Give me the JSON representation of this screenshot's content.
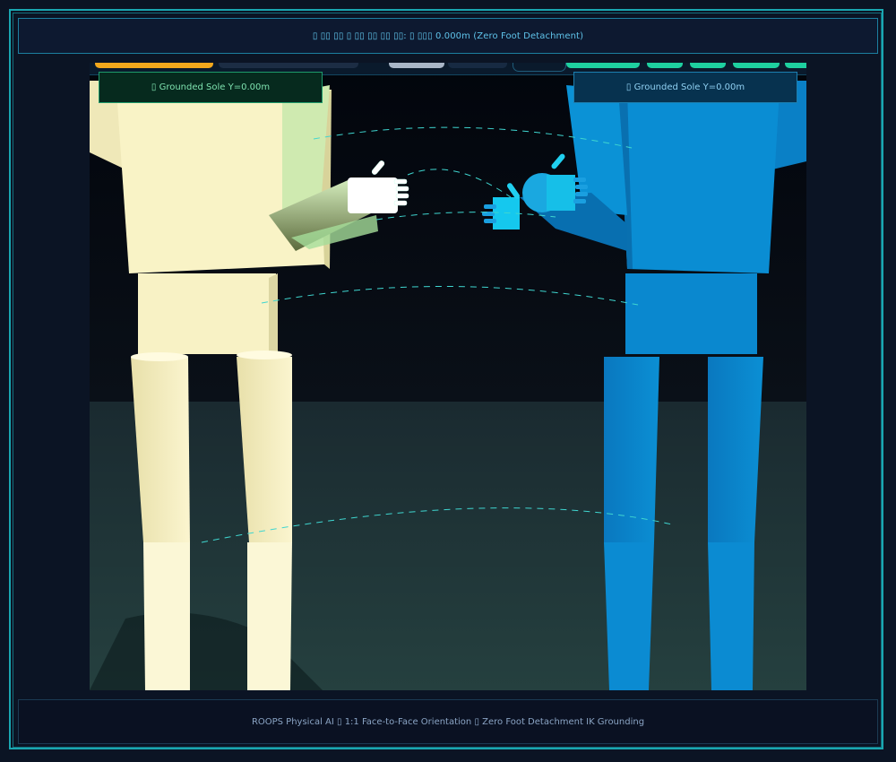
{
  "banner": {
    "text": "▯ ▯▯ ▯▯ ▯ ▯▯ ▯▯ ▯▯ ▯▯: ▯ ▯▯▯ 0.000m (Zero Foot Detachment)"
  },
  "viewport": {
    "left_badge": "▯ Grounded Sole Y=0.00m",
    "right_badge": "▯ Grounded Sole Y=0.00m"
  },
  "footer": {
    "text": "ROOPS Physical AI ▯ 1:1 Face-to-Face Orientation ▯ Zero Foot Detachment IK Grounding"
  },
  "colors": {
    "robot_left": "#f7f1c4",
    "robot_right": "#0a86cc",
    "accent": "#1aa6b0",
    "arc": "#3fd6d0"
  }
}
